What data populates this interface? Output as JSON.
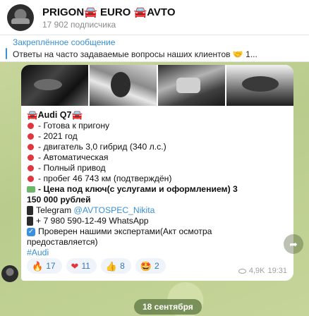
{
  "header": {
    "title": "PRIGON🚘 EURO 🚘AVTO",
    "subscribers": "17 902 подписчика"
  },
  "pinned": {
    "label": "Закреплённое сообщение",
    "text": "Ответы на часто задаваемые вопросы наших клиентов 🤝  1..."
  },
  "post": {
    "car": "🚘Audi Q7🚘",
    "items": [
      "- Готова к пригону",
      "- 2021 год",
      "- двигатель 3,0 гибрид (340 л.с.)",
      "- Автоматическая",
      "- Полный привод",
      "- пробег 46 743 км (подтверждён)"
    ],
    "price_line": "- Цена под ключ(с услугами и оформлением) 3",
    "price_line2": "150 000 рублей",
    "telegram_label": "Telegram ",
    "telegram_handle": "@AVTOSPEC_Nikita",
    "whatsapp": "+ 7 980 590-12-49 WhatsApp",
    "checked": "Проверен нашими экспертами(Акт осмотра",
    "checked2": "предоставляется)",
    "hashtag": "#Audi",
    "reactions": [
      {
        "emoji": "🔥",
        "count": "17"
      },
      {
        "emoji": "❤",
        "count": "11"
      },
      {
        "emoji": "👍",
        "count": "8"
      },
      {
        "emoji": "🤩",
        "count": "2"
      }
    ],
    "views": "4,9K",
    "time": "19:31"
  },
  "date_separator": "18 сентября",
  "colors": {
    "accent": "#3a8fd4",
    "bullet": "#e0363e",
    "wallpaper": "#c9d6a0"
  }
}
